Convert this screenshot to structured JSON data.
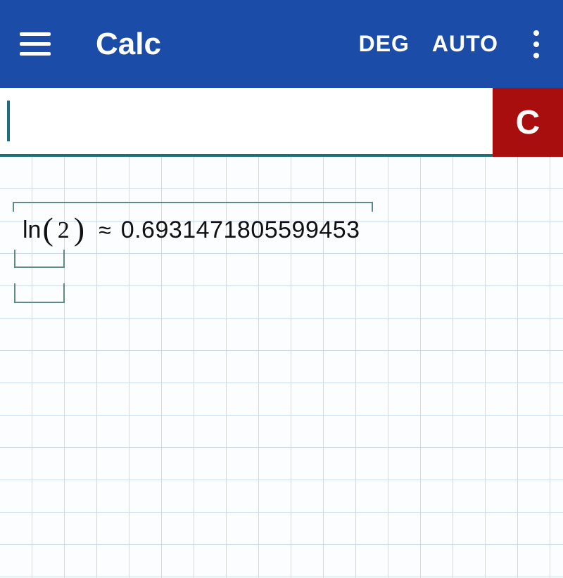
{
  "appbar": {
    "title": "Calc",
    "angle_mode": "DEG",
    "precision_mode": "AUTO"
  },
  "input": {
    "value": "",
    "clear_label": "C"
  },
  "result": {
    "function": "ln",
    "argument": "2",
    "approx_symbol": "≈",
    "value": "0.6931471805599453"
  }
}
